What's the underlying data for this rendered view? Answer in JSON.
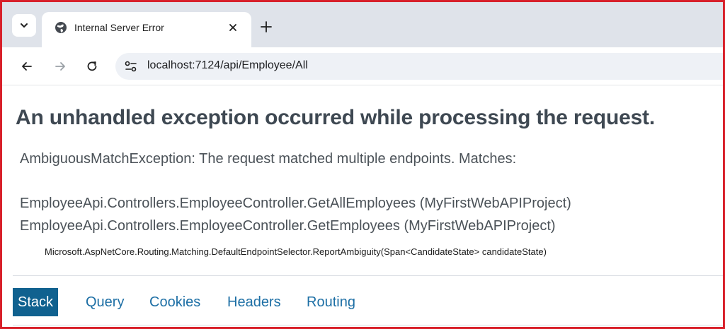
{
  "browser": {
    "tab": {
      "title": "Internal Server Error"
    },
    "address_bar": {
      "url": "localhost:7124/api/Employee/All"
    },
    "icons": [
      "tab-list-icon",
      "globe-icon",
      "close-icon",
      "plus-icon",
      "back-arrow-icon",
      "forward-arrow-icon",
      "reload-icon",
      "site-info-icon"
    ]
  },
  "page": {
    "title": "An unhandled exception occurred while processing the request.",
    "message": "AmbiguousMatchException: The request matched multiple endpoints. Matches:",
    "matches": [
      "EmployeeApi.Controllers.EmployeeController.GetAllEmployees (MyFirstWebAPIProject)",
      "EmployeeApi.Controllers.EmployeeController.GetEmployees (MyFirstWebAPIProject)"
    ],
    "location": "Microsoft.AspNetCore.Routing.Matching.DefaultEndpointSelector.ReportAmbiguity(Span<CandidateState> candidateState)",
    "tabs": [
      "Stack",
      "Query",
      "Cookies",
      "Headers",
      "Routing"
    ],
    "active_tab": "Stack"
  },
  "colors": {
    "frame_border": "#d8202a",
    "active_tab_bg": "#10618f",
    "link": "#1d6fa5",
    "title_text": "#3e4852"
  }
}
